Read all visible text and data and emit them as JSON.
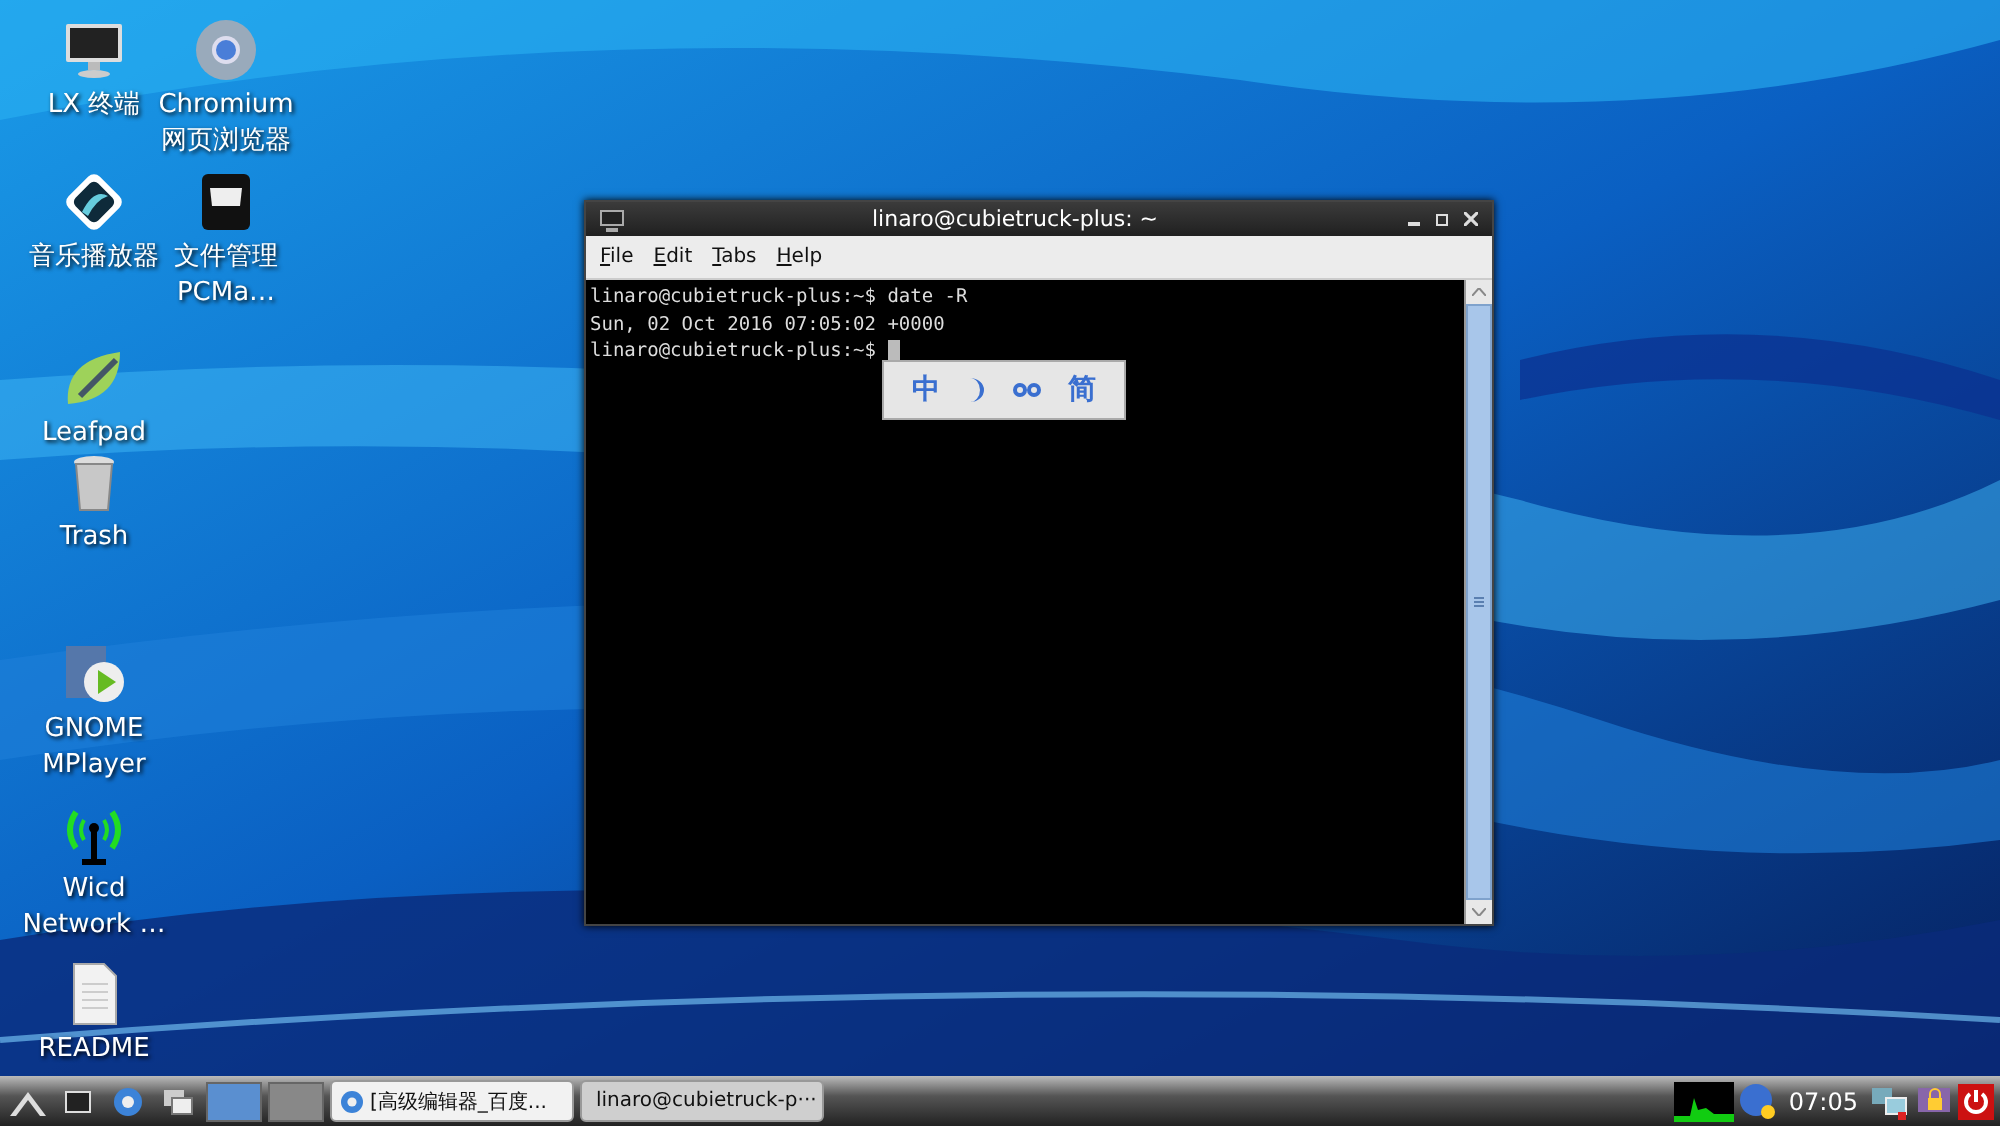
{
  "desktop_icons": [
    {
      "kind": "monitor",
      "lines": [
        "LX 终端"
      ]
    },
    {
      "kind": "browser",
      "lines": [
        "Chromium",
        "网页浏览器"
      ]
    },
    {
      "kind": "music",
      "lines": [
        "音乐播放器"
      ]
    },
    {
      "kind": "cabinet",
      "lines": [
        "文件管理",
        "PCMa…"
      ]
    },
    {
      "kind": "notepad",
      "lines": [
        "Leafpad"
      ]
    },
    {
      "kind": "trash",
      "lines": [
        "Trash"
      ]
    },
    {
      "kind": "player",
      "lines": [
        "GNOME",
        "MPlayer"
      ]
    },
    {
      "kind": "antenna",
      "lines": [
        "Wicd",
        "Network …"
      ]
    },
    {
      "kind": "document",
      "lines": [
        "README"
      ]
    }
  ],
  "terminal": {
    "title": "linaro@cubietruck-plus: ~",
    "menu": [
      "File",
      "Edit",
      "Tabs",
      "Help"
    ],
    "lines": [
      "linaro@cubietruck-plus:~$ date -R",
      "Sun, 02 Oct 2016 07:05:02 +0000",
      "linaro@cubietruck-plus:~$ "
    ]
  },
  "ime_bar": {
    "items": [
      {
        "kind": "text",
        "text": "中"
      },
      {
        "kind": "moon"
      },
      {
        "kind": "punct"
      },
      {
        "kind": "text",
        "text": "简"
      }
    ]
  },
  "taskbar": {
    "tasks": [
      {
        "kind": "browser",
        "label": "[高级编辑器_百度...",
        "selected": false
      },
      {
        "kind": "terminal",
        "label": "linaro@cubietruck-p···",
        "selected": true
      }
    ],
    "clock": "07:05"
  }
}
